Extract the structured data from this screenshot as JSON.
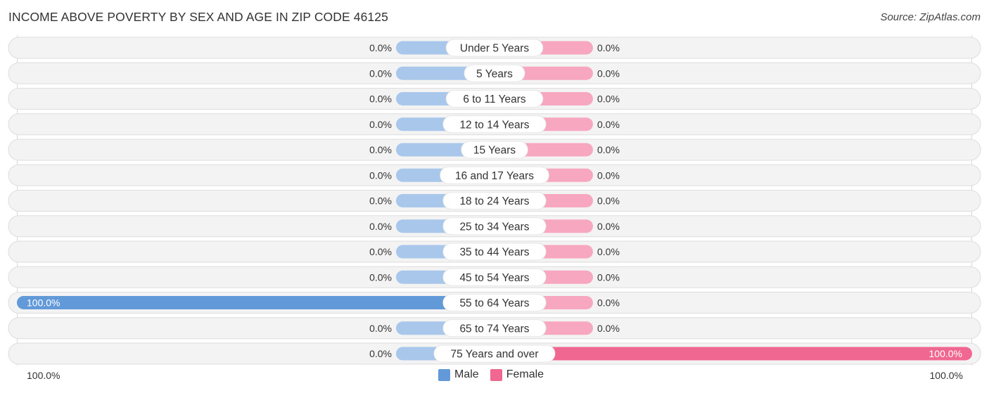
{
  "title": "INCOME ABOVE POVERTY BY SEX AND AGE IN ZIP CODE 46125",
  "source": "Source: ZipAtlas.com",
  "colors": {
    "male_full": "#6199d9",
    "male_stub": "#a9c7ea",
    "female_full": "#f06892",
    "female_stub": "#f7a8c0",
    "track": "#f3f3f3",
    "track_border": "#dddddd"
  },
  "axis": {
    "left_label": "100.0%",
    "right_label": "100.0%"
  },
  "legend": [
    {
      "label": "Male",
      "color": "#6199d9"
    },
    {
      "label": "Female",
      "color": "#f06892"
    }
  ],
  "chart_data": {
    "type": "bar",
    "orientation": "horizontal-diverging",
    "title": "INCOME ABOVE POVERTY BY SEX AND AGE IN ZIP CODE 46125",
    "xlabel": "",
    "ylabel": "",
    "xlim": [
      -100,
      100
    ],
    "legend_position": "bottom-center",
    "categories": [
      "Under 5 Years",
      "5 Years",
      "6 to 11 Years",
      "12 to 14 Years",
      "15 Years",
      "16 and 17 Years",
      "18 to 24 Years",
      "25 to 34 Years",
      "35 to 44 Years",
      "45 to 54 Years",
      "55 to 64 Years",
      "65 to 74 Years",
      "75 Years and over"
    ],
    "series": [
      {
        "name": "Male",
        "values": [
          0,
          0,
          0,
          0,
          0,
          0,
          0,
          0,
          0,
          0,
          100,
          0,
          0
        ],
        "labels": [
          "0.0%",
          "0.0%",
          "0.0%",
          "0.0%",
          "0.0%",
          "0.0%",
          "0.0%",
          "0.0%",
          "0.0%",
          "0.0%",
          "100.0%",
          "0.0%",
          "0.0%"
        ]
      },
      {
        "name": "Female",
        "values": [
          0,
          0,
          0,
          0,
          0,
          0,
          0,
          0,
          0,
          0,
          0,
          0,
          100
        ],
        "labels": [
          "0.0%",
          "0.0%",
          "0.0%",
          "0.0%",
          "0.0%",
          "0.0%",
          "0.0%",
          "0.0%",
          "0.0%",
          "0.0%",
          "0.0%",
          "0.0%",
          "100.0%"
        ]
      }
    ]
  }
}
